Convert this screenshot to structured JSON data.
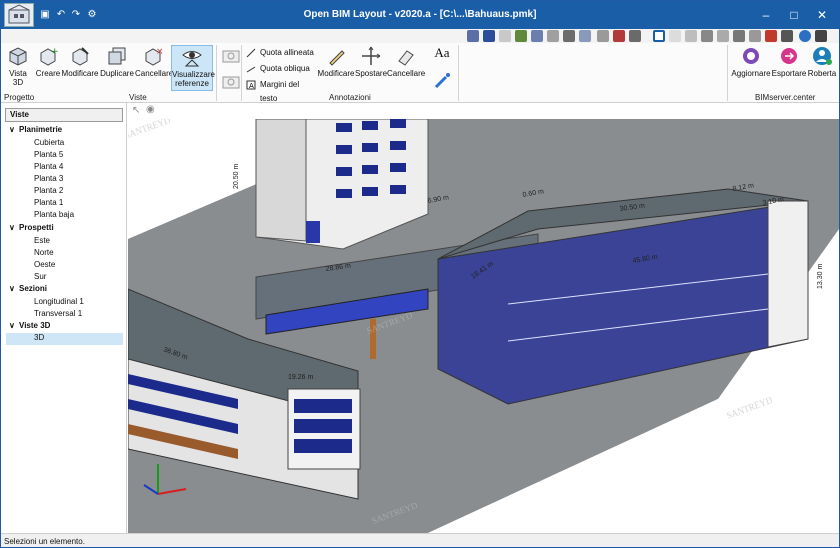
{
  "window": {
    "title": "Open BIM Layout - v2020.a - [C:\\...\\Bahuaus.pmk]"
  },
  "ribbon": {
    "buttons": {
      "vista3d": "Vista 3D",
      "creare": "Creare",
      "modificare": "Modificare",
      "duplicare": "Duplicare",
      "cancellare": "Cancellare",
      "visualizzare": "Visualizzare referenze",
      "quota_allineata": "Quota allineata",
      "quota_obliqua": "Quota obliqua",
      "margini_testo": "Margini del testo",
      "ann_modificare": "Modificare",
      "spostare": "Spostare",
      "ann_cancellare": "Cancellare",
      "aggiornare": "Aggiornare",
      "esportare": "Esportare",
      "roberta": "Roberta"
    },
    "groups": {
      "progetto": "Progetto",
      "viste": "Viste",
      "annotazioni": "Annotazioni",
      "bimserver": "BIMserver.center"
    },
    "text_icon": "Aa"
  },
  "panel": {
    "header": "Viste",
    "groups": [
      {
        "label": "Planimetrie",
        "items": [
          "Cubierta",
          "Planta 5",
          "Planta 4",
          "Planta 3",
          "Planta 2",
          "Planta 1",
          "Planta baja"
        ]
      },
      {
        "label": "Prospetti",
        "items": [
          "Este",
          "Norte",
          "Oeste",
          "Sur"
        ]
      },
      {
        "label": "Sezioni",
        "items": [
          "Longitudinal 1",
          "Transversal 1"
        ]
      },
      {
        "label": "Viste 3D",
        "items": [
          "3D"
        ]
      }
    ],
    "selected_item": "3D"
  },
  "viewport": {
    "dimensions": [
      "20.50 m",
      "28.86 m",
      "18.41 m",
      "45.80 m",
      "36.80 m",
      "19.26 m",
      "30.50 m",
      "13.30 m",
      "0.60 m",
      "8.12 m",
      "6.90 m",
      "3.10 m"
    ],
    "watermark": "SANTREYD"
  },
  "status": {
    "text": "Selezioni un elemento."
  },
  "colors": {
    "titlebar": "#1b5ea8",
    "selection": "#cfe6f6",
    "glass": "#1c2a8c",
    "roof": "#5f6970",
    "ground": "#8a8d90"
  }
}
